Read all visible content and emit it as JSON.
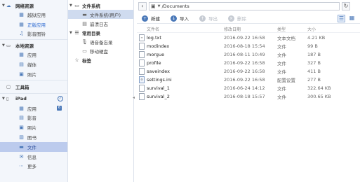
{
  "sidebar": {
    "network": {
      "title": "网络资源",
      "items": [
        {
          "label": "越狱应用",
          "icon": "apps-icon"
        },
        {
          "label": "正版应用",
          "icon": "apps-icon"
        },
        {
          "label": "影音图铃",
          "icon": "music-icon"
        }
      ]
    },
    "local": {
      "title": "本地资源",
      "items": [
        {
          "label": "应用",
          "icon": "apps-icon"
        },
        {
          "label": "媒体",
          "icon": "media-icon"
        },
        {
          "label": "照片",
          "icon": "photo-icon"
        }
      ]
    },
    "toolbox": {
      "title": "工具箱"
    },
    "device": {
      "title": "iPad",
      "items": [
        {
          "label": "应用",
          "badge": "6"
        },
        {
          "label": "影音"
        },
        {
          "label": "照片"
        },
        {
          "label": "图书"
        },
        {
          "label": "文件"
        },
        {
          "label": "信息"
        },
        {
          "label": "更多"
        }
      ]
    }
  },
  "tree": {
    "filesystem": {
      "title": "文件系统",
      "items": [
        {
          "label": "文件系统(用户)"
        },
        {
          "label": "崩溃日志"
        }
      ]
    },
    "common": {
      "title": "常用目录",
      "items": [
        {
          "label": "语音备忘录"
        },
        {
          "label": "移动硬盘"
        }
      ]
    },
    "bookmarks": {
      "title": "标签"
    }
  },
  "address": {
    "path": "/Documents"
  },
  "toolbar": {
    "new": "新建",
    "import": "导入",
    "export": "导出",
    "delete": "删除"
  },
  "columns": {
    "name": "文件名",
    "date": "修改日期",
    "type": "类型",
    "size": "大小"
  },
  "files": [
    {
      "name": "log.txt",
      "date": "2016-09-22 16:58",
      "type": "文本文档",
      "size": "4.21 KB"
    },
    {
      "name": "modindex",
      "date": "2016-08-18 15:54",
      "type": "文件",
      "size": "99 B"
    },
    {
      "name": "morgue",
      "date": "2016-08-11 10:49",
      "type": "文件",
      "size": "187 B"
    },
    {
      "name": "profile",
      "date": "2016-09-22 16:58",
      "type": "文件",
      "size": "327 B"
    },
    {
      "name": "saveindex",
      "date": "2016-09-22 16:58",
      "type": "文件",
      "size": "411 B"
    },
    {
      "name": "settings.ini",
      "date": "2016-09-22 16:58",
      "type": "配置设置",
      "size": "277 B"
    },
    {
      "name": "survival_1",
      "date": "2016-06-24 14:12",
      "type": "文件",
      "size": "322.64 KB"
    },
    {
      "name": "survival_2",
      "date": "2016-08-18 15:57",
      "type": "文件",
      "size": "300.65 KB"
    }
  ]
}
